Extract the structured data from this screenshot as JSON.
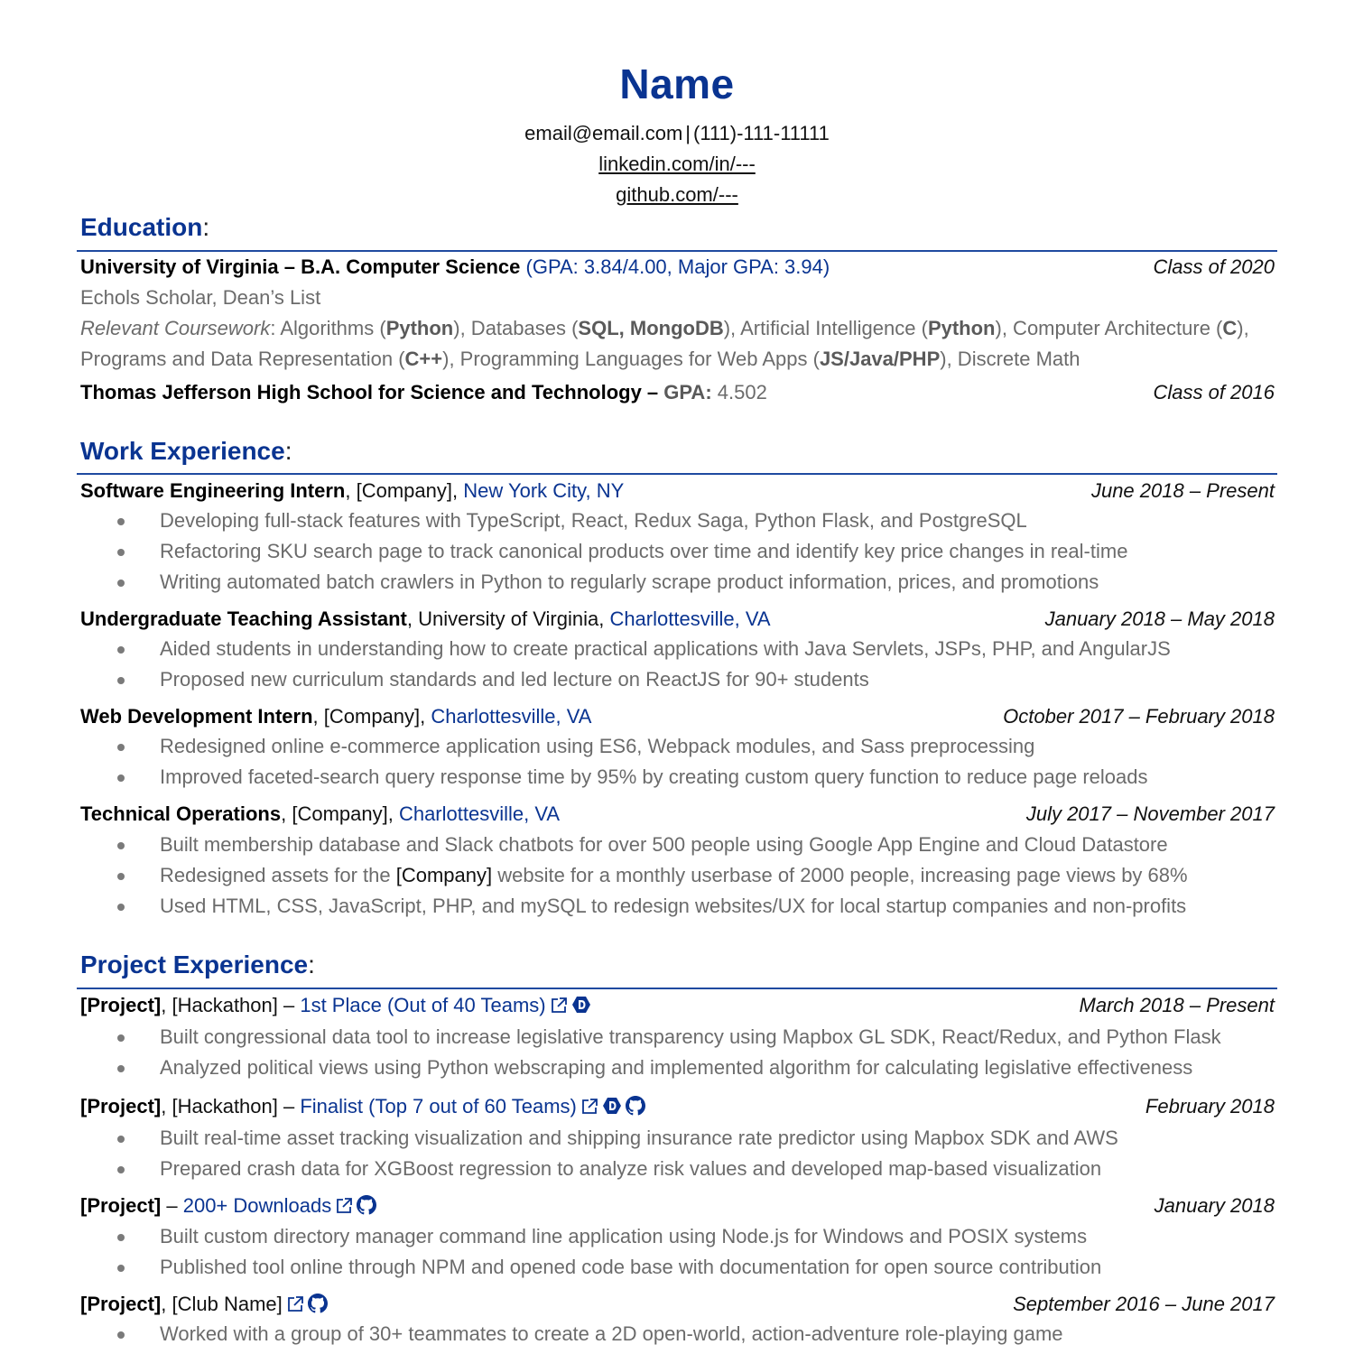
{
  "header": {
    "name": "Name",
    "email": "email@email.com",
    "separator": "|",
    "phone": "(111)-111-11111",
    "linkedin": "linkedin.com/in/---",
    "github": "github.com/---"
  },
  "sections": {
    "education": {
      "title": "Education",
      "colon": ":"
    },
    "work": {
      "title": "Work Experience",
      "colon": ":"
    },
    "projects": {
      "title": "Project Experience",
      "colon": ":"
    }
  },
  "education": {
    "uva": {
      "school": "University of Virginia – B.A. Computer Science",
      "gpa": "(GPA: 3.84/4.00, Major GPA: 3.94)",
      "date": "Class of 2020",
      "honors": "Echols Scholar, Dean’s List",
      "coursework_label": "Relevant Coursework",
      "coursework_line1": [
        {
          "t": ": Algorithms (",
          "b": false
        },
        {
          "t": "Python",
          "b": true
        },
        {
          "t": "), Databases (",
          "b": false
        },
        {
          "t": "SQL, MongoDB",
          "b": true
        },
        {
          "t": "), Artificial Intelligence (",
          "b": false
        },
        {
          "t": "Python",
          "b": true
        },
        {
          "t": "), Computer Architecture (",
          "b": false
        },
        {
          "t": "C",
          "b": true
        },
        {
          "t": "),",
          "b": false
        }
      ],
      "coursework_line2": [
        {
          "t": "Programs and Data Representation (",
          "b": false
        },
        {
          "t": "C++",
          "b": true
        },
        {
          "t": "), Programming Languages for Web Apps (",
          "b": false
        },
        {
          "t": "JS/Java/PHP",
          "b": true
        },
        {
          "t": "), Discrete Math",
          "b": false
        }
      ]
    },
    "tj": {
      "school": "Thomas Jefferson High School for Science and Technology –",
      "gpa_label": "GPA:",
      "gpa_value": "4.502",
      "date": "Class of 2016"
    }
  },
  "work": [
    {
      "title": "Software Engineering Intern",
      "org": ", [Company], ",
      "location": "New York City, NY",
      "date": "June 2018 – Present",
      "bullets": [
        "Developing full-stack features with TypeScript, React, Redux Saga, Python Flask, and PostgreSQL",
        "Refactoring SKU search page to track canonical products over time and identify key price changes in real-time",
        "Writing automated batch crawlers in Python to regularly scrape product information, prices, and promotions"
      ]
    },
    {
      "title": "Undergraduate Teaching Assistant",
      "org": ", University of Virginia, ",
      "location": "Charlottesville, VA",
      "date": "January 2018 – May 2018",
      "bullets": [
        "Aided students in understanding how to create practical applications with Java Servlets, JSPs, PHP, and AngularJS",
        "Proposed new curriculum standards and led lecture on ReactJS for 90+ students"
      ]
    },
    {
      "title": "Web Development Intern",
      "org": ", [Company], ",
      "location": "Charlottesville, VA",
      "date": "October 2017 – February 2018",
      "bullets": [
        "Redesigned online e-commerce application using ES6, Webpack modules, and Sass preprocessing",
        "Improved faceted-search query response time by 95% by creating custom query function to reduce page reloads"
      ]
    },
    {
      "title": "Technical Operations",
      "org": ", [Company], ",
      "location": "Charlottesville, VA",
      "date": "July 2017 – November 2017",
      "bullets": [
        "Built membership database and Slack chatbots for over 500 people using Google App Engine and Cloud Datastore",
        "Redesigned assets for the [Company] website for a monthly userbase of 2000 people, increasing page views by 68%",
        "Used HTML, CSS, JavaScript, PHP, and mySQL to redesign websites/UX for local startup companies and non-profits"
      ],
      "bullet2_parts": {
        "before": "Redesigned assets for the ",
        "highlight": "[Company]",
        "after": " website for a monthly userbase of 2000 people, increasing page views by 68%"
      }
    }
  ],
  "projects": [
    {
      "title": "[Project]",
      "org": ", [Hackathon] – ",
      "award": "1st Place (Out of 40 Teams)",
      "icons": [
        "external-link-icon",
        "devpost-icon"
      ],
      "date": "March 2018 – Present",
      "bullets": [
        "Built congressional data tool to increase legislative transparency using Mapbox GL SDK, React/Redux, and Python Flask",
        "Analyzed political views using Python webscraping and implemented algorithm for calculating legislative effectiveness"
      ]
    },
    {
      "title": "[Project]",
      "org": ", [Hackathon] – ",
      "award": "Finalist (Top 7 out of 60 Teams)",
      "icons": [
        "external-link-icon",
        "devpost-icon",
        "github-icon"
      ],
      "date": "February 2018",
      "bullets": [
        "Built real-time asset tracking visualization and shipping insurance rate predictor using Mapbox SDK and AWS",
        "Prepared crash data for XGBoost regression to analyze risk values and developed map-based visualization"
      ]
    },
    {
      "title": "[Project]",
      "org": " – ",
      "award": "200+ Downloads",
      "icons": [
        "external-link-icon",
        "github-icon"
      ],
      "date": "January 2018",
      "bullets": [
        "Built custom directory manager command line application using Node.js for Windows and POSIX systems",
        "Published tool online through NPM and opened code base with documentation for open source contribution"
      ]
    },
    {
      "title": "[Project]",
      "org": ", [Club Name]",
      "award": "",
      "icons": [
        "external-link-icon",
        "github-icon"
      ],
      "date": "September 2016 – June 2017",
      "bullets": [
        "Worked with a group of 30+ teammates to create a 2D open-world, action-adventure role-playing game"
      ]
    }
  ],
  "colors": {
    "accent": "#0a3491",
    "body_text": "#6b6b6b",
    "heading_text": "#000000",
    "rule": "#1f4aa0"
  }
}
